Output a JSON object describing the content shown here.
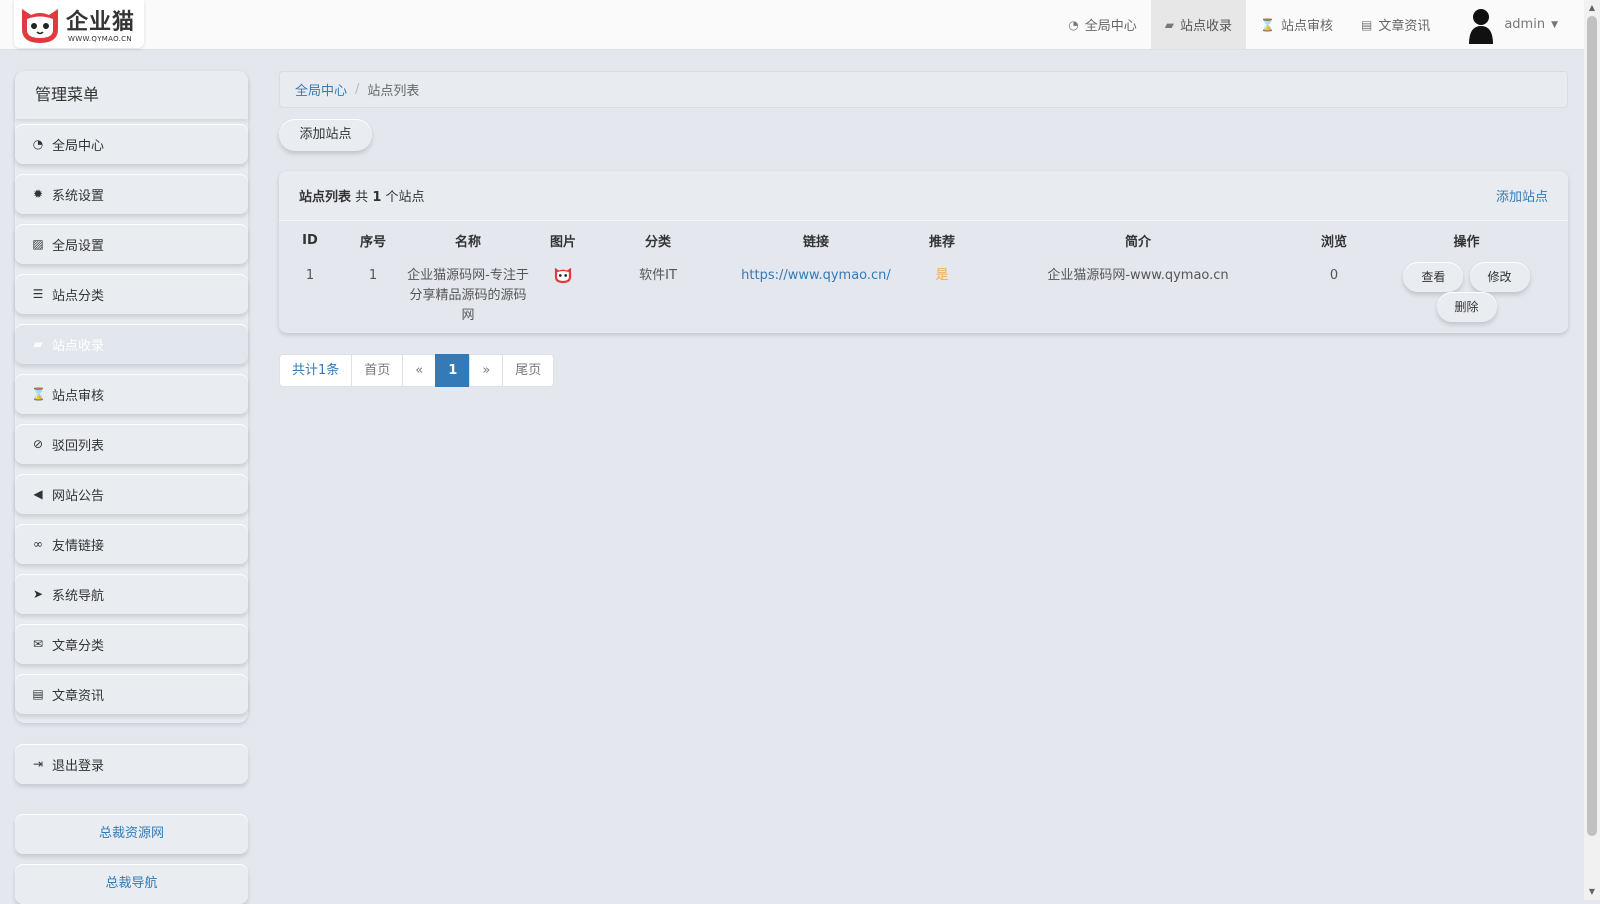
{
  "logo": {
    "name": "企业猫",
    "url": "WWW.QYMAO.CN"
  },
  "topnav": {
    "items": [
      {
        "icon": "dashboard-icon",
        "label": "全局中心"
      },
      {
        "icon": "book-icon",
        "label": "站点收录",
        "active": true
      },
      {
        "icon": "hourglass-icon",
        "label": "站点审核"
      },
      {
        "icon": "newspaper-icon",
        "label": "文章资讯"
      }
    ],
    "user": "admin"
  },
  "sidebar": {
    "title": "管理菜单",
    "items": [
      {
        "icon": "dashboard-icon",
        "label": "全局中心"
      },
      {
        "icon": "gear-icon",
        "label": "系统设置"
      },
      {
        "icon": "picture-icon",
        "label": "全局设置"
      },
      {
        "icon": "sliders-icon",
        "label": "站点分类"
      },
      {
        "icon": "book-icon",
        "label": "站点收录",
        "active": true
      },
      {
        "icon": "hourglass-icon",
        "label": "站点审核"
      },
      {
        "icon": "ban-icon",
        "label": "驳回列表"
      },
      {
        "icon": "bullhorn-icon",
        "label": "网站公告"
      },
      {
        "icon": "handshake-icon",
        "label": "友情链接"
      },
      {
        "icon": "location-arrow-icon",
        "label": "系统导航"
      },
      {
        "icon": "envelope-icon",
        "label": "文章分类"
      },
      {
        "icon": "newspaper-icon",
        "label": "文章资讯"
      }
    ],
    "logout": {
      "icon": "sign-out-icon",
      "label": "退出登录"
    },
    "links": [
      "总裁资源网",
      "总裁导航"
    ]
  },
  "breadcrumb": {
    "home": "全局中心",
    "sep": "/",
    "current": "站点列表"
  },
  "add_button": "添加站点",
  "panel": {
    "title": "站点列表",
    "count_prefix": "共",
    "count": "1",
    "count_suffix": "个站点",
    "add_link": "添加站点"
  },
  "table": {
    "headers": [
      "ID",
      "序号",
      "名称",
      "图片",
      "分类",
      "链接",
      "推荐",
      "简介",
      "浏览",
      "操作"
    ],
    "rows": [
      {
        "id": "1",
        "order": "1",
        "name": "企业猫源码网-专注于分享精品源码的源码网",
        "category": "软件IT",
        "link": "https://www.qymao.cn/",
        "recommend": "是",
        "intro": "企业猫源码网-www.qymao.cn",
        "views": "0",
        "actions": {
          "view": "查看",
          "edit": "修改",
          "delete": "删除"
        }
      }
    ]
  },
  "pagination": {
    "total": "共计1条",
    "first": "首页",
    "prev": "«",
    "current": "1",
    "next": "»",
    "last": "尾页"
  },
  "colors": {
    "accent": "#337ab7",
    "recommend": "#f0ad4e",
    "background": "#e4e8ee",
    "logo_red": "#e0393e"
  }
}
